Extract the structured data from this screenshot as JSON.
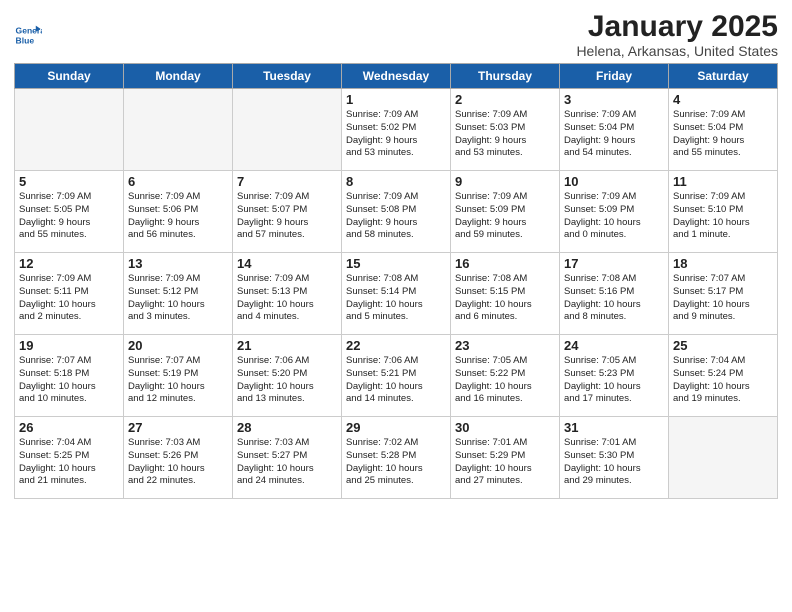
{
  "header": {
    "logo_line1": "General",
    "logo_line2": "Blue",
    "title": "January 2025",
    "subtitle": "Helena, Arkansas, United States"
  },
  "days": [
    "Sunday",
    "Monday",
    "Tuesday",
    "Wednesday",
    "Thursday",
    "Friday",
    "Saturday"
  ],
  "weeks": [
    [
      {
        "date": "",
        "info": ""
      },
      {
        "date": "",
        "info": ""
      },
      {
        "date": "",
        "info": ""
      },
      {
        "date": "1",
        "info": "Sunrise: 7:09 AM\nSunset: 5:02 PM\nDaylight: 9 hours\nand 53 minutes."
      },
      {
        "date": "2",
        "info": "Sunrise: 7:09 AM\nSunset: 5:03 PM\nDaylight: 9 hours\nand 53 minutes."
      },
      {
        "date": "3",
        "info": "Sunrise: 7:09 AM\nSunset: 5:04 PM\nDaylight: 9 hours\nand 54 minutes."
      },
      {
        "date": "4",
        "info": "Sunrise: 7:09 AM\nSunset: 5:04 PM\nDaylight: 9 hours\nand 55 minutes."
      }
    ],
    [
      {
        "date": "5",
        "info": "Sunrise: 7:09 AM\nSunset: 5:05 PM\nDaylight: 9 hours\nand 55 minutes."
      },
      {
        "date": "6",
        "info": "Sunrise: 7:09 AM\nSunset: 5:06 PM\nDaylight: 9 hours\nand 56 minutes."
      },
      {
        "date": "7",
        "info": "Sunrise: 7:09 AM\nSunset: 5:07 PM\nDaylight: 9 hours\nand 57 minutes."
      },
      {
        "date": "8",
        "info": "Sunrise: 7:09 AM\nSunset: 5:08 PM\nDaylight: 9 hours\nand 58 minutes."
      },
      {
        "date": "9",
        "info": "Sunrise: 7:09 AM\nSunset: 5:09 PM\nDaylight: 9 hours\nand 59 minutes."
      },
      {
        "date": "10",
        "info": "Sunrise: 7:09 AM\nSunset: 5:09 PM\nDaylight: 10 hours\nand 0 minutes."
      },
      {
        "date": "11",
        "info": "Sunrise: 7:09 AM\nSunset: 5:10 PM\nDaylight: 10 hours\nand 1 minute."
      }
    ],
    [
      {
        "date": "12",
        "info": "Sunrise: 7:09 AM\nSunset: 5:11 PM\nDaylight: 10 hours\nand 2 minutes."
      },
      {
        "date": "13",
        "info": "Sunrise: 7:09 AM\nSunset: 5:12 PM\nDaylight: 10 hours\nand 3 minutes."
      },
      {
        "date": "14",
        "info": "Sunrise: 7:09 AM\nSunset: 5:13 PM\nDaylight: 10 hours\nand 4 minutes."
      },
      {
        "date": "15",
        "info": "Sunrise: 7:08 AM\nSunset: 5:14 PM\nDaylight: 10 hours\nand 5 minutes."
      },
      {
        "date": "16",
        "info": "Sunrise: 7:08 AM\nSunset: 5:15 PM\nDaylight: 10 hours\nand 6 minutes."
      },
      {
        "date": "17",
        "info": "Sunrise: 7:08 AM\nSunset: 5:16 PM\nDaylight: 10 hours\nand 8 minutes."
      },
      {
        "date": "18",
        "info": "Sunrise: 7:07 AM\nSunset: 5:17 PM\nDaylight: 10 hours\nand 9 minutes."
      }
    ],
    [
      {
        "date": "19",
        "info": "Sunrise: 7:07 AM\nSunset: 5:18 PM\nDaylight: 10 hours\nand 10 minutes."
      },
      {
        "date": "20",
        "info": "Sunrise: 7:07 AM\nSunset: 5:19 PM\nDaylight: 10 hours\nand 12 minutes."
      },
      {
        "date": "21",
        "info": "Sunrise: 7:06 AM\nSunset: 5:20 PM\nDaylight: 10 hours\nand 13 minutes."
      },
      {
        "date": "22",
        "info": "Sunrise: 7:06 AM\nSunset: 5:21 PM\nDaylight: 10 hours\nand 14 minutes."
      },
      {
        "date": "23",
        "info": "Sunrise: 7:05 AM\nSunset: 5:22 PM\nDaylight: 10 hours\nand 16 minutes."
      },
      {
        "date": "24",
        "info": "Sunrise: 7:05 AM\nSunset: 5:23 PM\nDaylight: 10 hours\nand 17 minutes."
      },
      {
        "date": "25",
        "info": "Sunrise: 7:04 AM\nSunset: 5:24 PM\nDaylight: 10 hours\nand 19 minutes."
      }
    ],
    [
      {
        "date": "26",
        "info": "Sunrise: 7:04 AM\nSunset: 5:25 PM\nDaylight: 10 hours\nand 21 minutes."
      },
      {
        "date": "27",
        "info": "Sunrise: 7:03 AM\nSunset: 5:26 PM\nDaylight: 10 hours\nand 22 minutes."
      },
      {
        "date": "28",
        "info": "Sunrise: 7:03 AM\nSunset: 5:27 PM\nDaylight: 10 hours\nand 24 minutes."
      },
      {
        "date": "29",
        "info": "Sunrise: 7:02 AM\nSunset: 5:28 PM\nDaylight: 10 hours\nand 25 minutes."
      },
      {
        "date": "30",
        "info": "Sunrise: 7:01 AM\nSunset: 5:29 PM\nDaylight: 10 hours\nand 27 minutes."
      },
      {
        "date": "31",
        "info": "Sunrise: 7:01 AM\nSunset: 5:30 PM\nDaylight: 10 hours\nand 29 minutes."
      },
      {
        "date": "",
        "info": ""
      }
    ]
  ]
}
